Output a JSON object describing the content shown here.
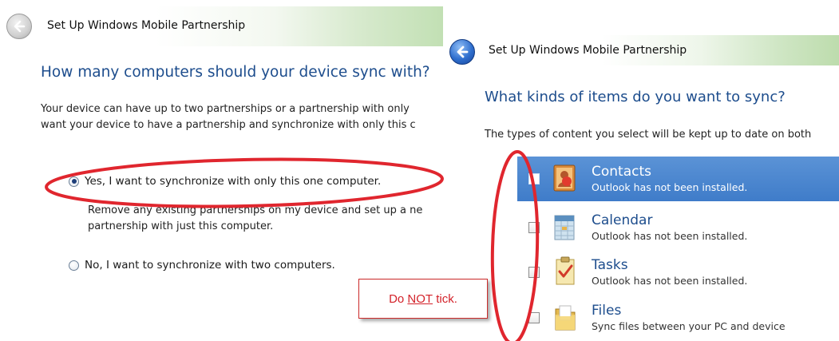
{
  "left_wizard": {
    "title": "Set Up Windows Mobile Partnership",
    "heading": "How many computers should your device sync with?",
    "body_lines": [
      "Your device can have up to two partnerships or a partnership with only",
      "want your device to have a partnership and synchronize with only this c"
    ],
    "option_yes": {
      "label": "Yes, I want to synchronize with only this one computer.",
      "checked": true,
      "sub_lines": [
        "Remove any existing partnerships on my device and set up a ne",
        "partnership with just this computer."
      ]
    },
    "option_no": {
      "label": "No, I want to synchronize with two computers.",
      "checked": false
    }
  },
  "right_wizard": {
    "title": "Set Up Windows Mobile Partnership",
    "heading": "What kinds of items do you want to sync?",
    "body": "The types of content you select will be kept up to date on both",
    "items": [
      {
        "title": "Contacts",
        "desc": "Outlook has not been installed.",
        "icon": "contacts-icon",
        "checked": false,
        "selected": true
      },
      {
        "title": "Calendar",
        "desc": "Outlook has not been installed.",
        "icon": "calendar-icon",
        "checked": false,
        "selected": false
      },
      {
        "title": "Tasks",
        "desc": "Outlook has not been installed.",
        "icon": "tasks-icon",
        "checked": false,
        "selected": false
      },
      {
        "title": "Files",
        "desc": "Sync files between your PC and device",
        "icon": "folder-icon",
        "checked": false,
        "selected": false
      }
    ]
  },
  "annotation": {
    "note_before": "Do ",
    "note_emphasis": "NOT",
    "note_after": " tick.",
    "color": "#e0262e"
  }
}
